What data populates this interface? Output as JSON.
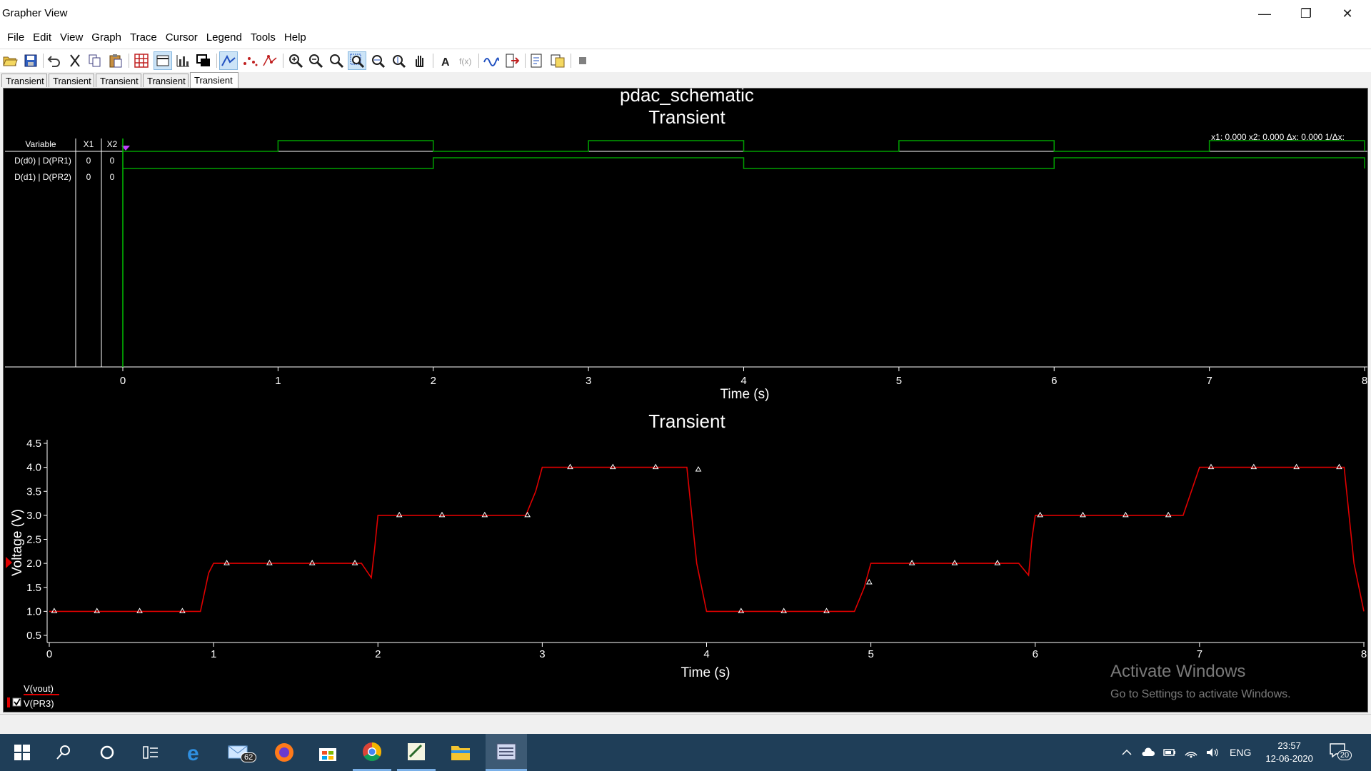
{
  "window": {
    "title": "Grapher View",
    "minimize": "—",
    "restore": "❐",
    "close": "✕"
  },
  "menu": [
    "File",
    "Edit",
    "View",
    "Graph",
    "Trace",
    "Cursor",
    "Legend",
    "Tools",
    "Help"
  ],
  "tabs": [
    "Transient",
    "Transient",
    "Transient",
    "Transient",
    "Transient"
  ],
  "active_tab_index": 4,
  "digital_plot": {
    "header": "pdac_schematic",
    "title": "Transient",
    "cursor_readout": "x1:  0.000  x2:  0.000  Δx:  0.000  1/Δx:",
    "table_headers": [
      "Variable",
      "X1",
      "X2"
    ],
    "rows": [
      {
        "name": "D(d0) | D(PR1)",
        "x1": "0",
        "x2": "0"
      },
      {
        "name": "D(d1) | D(PR2)",
        "x1": "0",
        "x2": "0"
      }
    ],
    "xlabel": "Time (s)"
  },
  "chart_data": [
    {
      "type": "line",
      "title": "",
      "xlabel": "Time (s)",
      "xlim": [
        0,
        8
      ],
      "xticks": [
        "0",
        "1",
        "2",
        "3",
        "4",
        "5",
        "6",
        "7",
        "8"
      ],
      "series": [
        {
          "name": "D(d0) | D(PR1)",
          "color": "#00a000",
          "x": [
            0,
            1,
            2,
            3,
            4,
            5,
            6,
            7,
            8
          ],
          "values": [
            0,
            1,
            0,
            1,
            0,
            1,
            0,
            1,
            0
          ]
        },
        {
          "name": "D(d1) | D(PR2)",
          "color": "#00a000",
          "x": [
            0,
            2,
            4,
            6,
            8
          ],
          "values": [
            0,
            1,
            0,
            1,
            0
          ]
        }
      ]
    },
    {
      "type": "line",
      "title": "Transient",
      "xlabel": "Time (s)",
      "ylabel": "Voltage (V)",
      "xlim": [
        0,
        8
      ],
      "ylim": [
        0.5,
        4.5
      ],
      "xticks": [
        "0",
        "1",
        "2",
        "3",
        "4",
        "5",
        "6",
        "7",
        "8"
      ],
      "yticks": [
        "0.5",
        "1.0",
        "1.5",
        "2.0",
        "2.5",
        "3.0",
        "3.5",
        "4.0",
        "4.5"
      ],
      "series": [
        {
          "name": "V(vout)",
          "color": "#e00000",
          "x": [
            0,
            0.92,
            0.97,
            1.0,
            1.9,
            1.96,
            1.98,
            2.0,
            2.9,
            2.96,
            3.0,
            3.88,
            3.94,
            4.0,
            4.9,
            4.96,
            5.0,
            5.9,
            5.96,
            5.98,
            6.0,
            6.9,
            6.96,
            7.0,
            7.88,
            7.94,
            8.0
          ],
          "values": [
            1.0,
            1.0,
            1.8,
            2.0,
            2.0,
            1.7,
            2.3,
            3.0,
            3.0,
            3.5,
            4.0,
            4.0,
            2.0,
            1.0,
            1.0,
            1.5,
            2.0,
            2.0,
            1.75,
            2.5,
            3.0,
            3.0,
            3.6,
            4.0,
            4.0,
            2.0,
            1.0
          ]
        },
        {
          "name": "markers",
          "color": "#ffffff",
          "x": [
            0.03,
            0.29,
            0.55,
            0.81,
            1.08,
            1.34,
            1.6,
            1.86,
            2.13,
            2.39,
            2.65,
            2.91,
            3.17,
            3.43,
            3.69,
            3.95,
            4.21,
            4.47,
            4.73,
            4.99,
            5.25,
            5.51,
            5.77,
            6.03,
            6.29,
            6.55,
            6.81,
            7.07,
            7.33,
            7.59,
            7.85
          ],
          "values": [
            1.0,
            1.0,
            1.0,
            1.0,
            2.0,
            2.0,
            2.0,
            2.0,
            3.0,
            3.0,
            3.0,
            3.0,
            4.0,
            4.0,
            4.0,
            3.95,
            1.0,
            1.0,
            1.0,
            1.6,
            2.0,
            2.0,
            2.0,
            3.0,
            3.0,
            3.0,
            3.0,
            4.0,
            4.0,
            4.0,
            4.0
          ]
        }
      ],
      "legend": [
        "V(vout)",
        "V(PR3)"
      ]
    }
  ],
  "watermark": {
    "line1": "Activate Windows",
    "line2": "Go to Settings to activate Windows."
  },
  "taskbar": {
    "mail_badge": "62",
    "language": "ENG",
    "time": "23:57",
    "date": "12-06-2020",
    "notification_count": "20"
  }
}
